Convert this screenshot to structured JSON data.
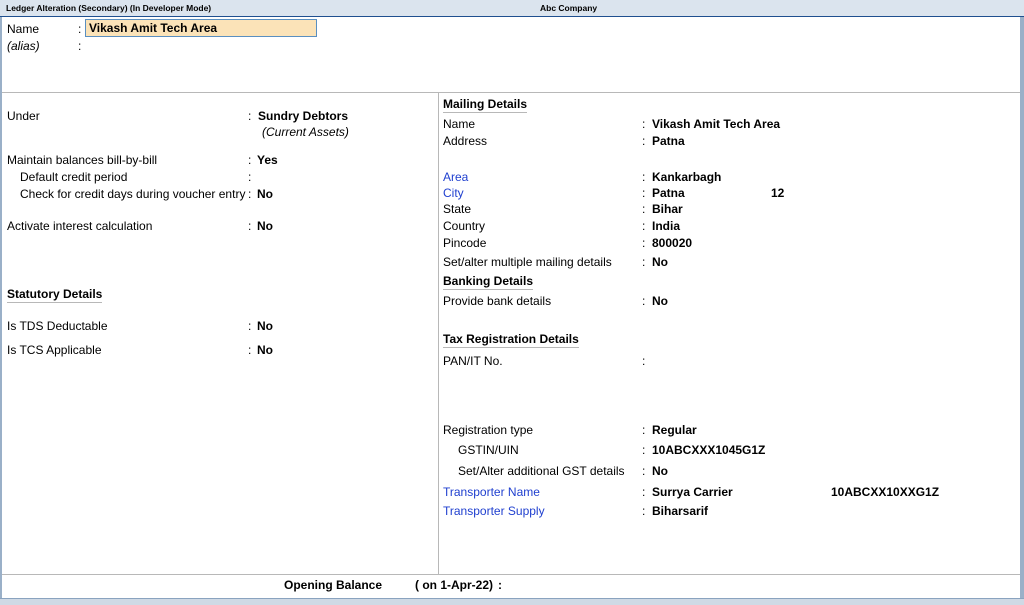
{
  "window": {
    "title": "Ledger Alteration (Secondary) (In Developer Mode)",
    "company": "Abc Company"
  },
  "header": {
    "name_label": "Name",
    "name_value": "Vikash Amit Tech Area",
    "alias_label": "(alias)",
    "colon": ":"
  },
  "left": {
    "under_label": "Under",
    "under_value": "Sundry Debtors",
    "under_group": "(Current Assets)",
    "bill_by_bill_label": "Maintain balances bill-by-bill",
    "bill_by_bill_value": "Yes",
    "credit_period_label": "Default credit period",
    "credit_days_label": "Check for credit days during voucher entry",
    "credit_days_value": "No",
    "interest_label": "Activate interest calculation",
    "interest_value": "No",
    "statutory_title": "Statutory Details",
    "tds_label": "Is TDS Deductable",
    "tds_value": "No",
    "tcs_label": "Is TCS Applicable",
    "tcs_value": "No"
  },
  "mailing": {
    "title": "Mailing Details",
    "name_label": "Name",
    "name_value": "Vikash Amit Tech Area",
    "address_label": "Address",
    "address_value": "Patna",
    "area_label": "Area",
    "area_value": "Kankarbagh",
    "city_label": "City",
    "city_value": "Patna",
    "city_extra": "12",
    "state_label": "State",
    "state_value": "Bihar",
    "country_label": "Country",
    "country_value": "India",
    "pincode_label": "Pincode",
    "pincode_value": "800020",
    "multiple_label": "Set/alter multiple mailing details",
    "multiple_value": "No"
  },
  "banking": {
    "title": "Banking Details",
    "bank_label": "Provide bank details",
    "bank_value": "No"
  },
  "tax": {
    "title": "Tax Registration Details",
    "pan_label": "PAN/IT No.",
    "reg_type_label": "Registration type",
    "reg_type_value": "Regular",
    "gstin_label": "GSTIN/UIN",
    "gstin_value": "10ABCXXX1045G1Z",
    "additional_label": "Set/Alter additional GST details",
    "additional_value": "No",
    "transporter_name_label": "Transporter Name",
    "transporter_name_value": "Surrya Carrier",
    "transporter_gstin": "10ABCXX10XXG1Z",
    "transporter_supply_label": "Transporter Supply",
    "transporter_supply_value": "Biharsarif"
  },
  "footer": {
    "opening_label": "Opening Balance",
    "opening_date": "( on 1-Apr-22)",
    "colon": ":"
  }
}
